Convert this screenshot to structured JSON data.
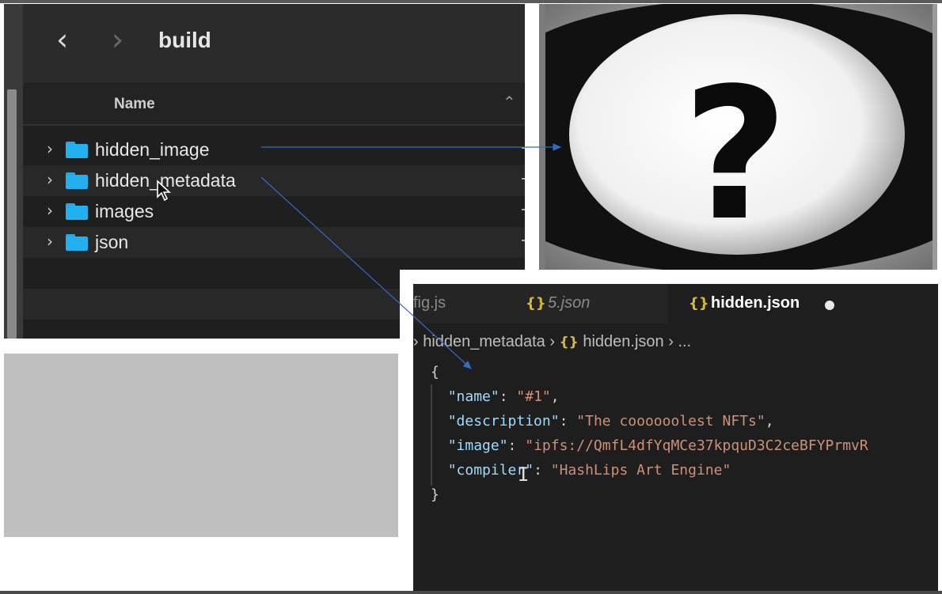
{
  "finder": {
    "back_icon": "chevron-left-icon",
    "forward_icon": "chevron-right-icon",
    "title": "build",
    "column_name": "Name",
    "sort_icon": "chevron-up-icon",
    "items": [
      {
        "label": "hidden_image"
      },
      {
        "label": "hidden_metadata"
      },
      {
        "label": "images"
      },
      {
        "label": "json"
      }
    ]
  },
  "image_panel": {
    "glyph": "?"
  },
  "editor": {
    "tabs": [
      {
        "label": "fig.js"
      },
      {
        "icon": "{}",
        "label": "5.json"
      },
      {
        "icon": "{}",
        "label": "hidden.json"
      }
    ],
    "breadcrumb": {
      "prefix": "› ",
      "folder": "hidden_metadata",
      "sep1": " › ",
      "icon": "{}",
      "file": " hidden.json",
      "sep2": " › ...",
      "full": "› hidden_metadata › {} hidden.json › ..."
    },
    "code": {
      "open_brace": "{",
      "close_brace": "}",
      "lines": [
        {
          "key": "\"name\"",
          "value": "\"#1\"",
          "suffix": ","
        },
        {
          "key": "\"description\"",
          "value": "\"The coooooolest NFTs\"",
          "suffix": ","
        },
        {
          "key": "\"image\"",
          "value": "\"ipfs://QmfL4dfYqMCe37kpquD3C2ceBFYPrmvR",
          "suffix": ""
        },
        {
          "key": "\"compiler\"",
          "value": "\"HashLips Art Engine\"",
          "suffix": ""
        }
      ]
    }
  },
  "colors": {
    "arrow": "#2e6fc4",
    "folder": "#22b0ee",
    "json_key": "#9cdcfe",
    "json_string": "#ce9178"
  }
}
